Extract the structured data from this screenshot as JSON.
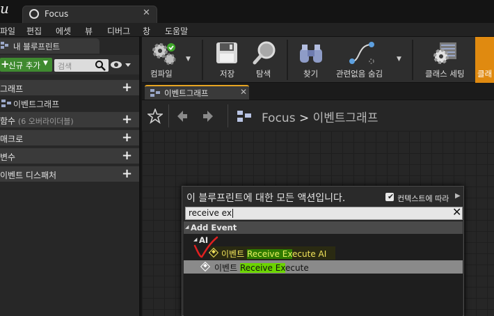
{
  "window": {
    "tab_title": "Focus",
    "close_glyph": "✕"
  },
  "menubar": {
    "items": [
      "파일",
      "편집",
      "에셋",
      "뷰",
      "디버그",
      "창",
      "도움말"
    ]
  },
  "left_panel": {
    "tab_label": "내 블루프린트",
    "add_new_label": "신규 추가",
    "search_placeholder": "검색",
    "sections": {
      "graphs": "그래프",
      "event_graph": "이벤트그래프",
      "functions": "함수",
      "functions_sub": "(6 오버라이더블)",
      "macros": "매크로",
      "variables": "변수",
      "event_dispatchers": "이벤트 디스패처"
    }
  },
  "toolbar": {
    "compile": "컴파일",
    "save": "저장",
    "browse": "탐색",
    "find": "찾기",
    "hide_unrelated": "관련없음 숨김",
    "class_settings": "클래스 세팅",
    "class_defaults": "클래"
  },
  "graph_tab": {
    "label": "이벤트그래프"
  },
  "breadcrumb": {
    "root": "Focus",
    "separator": ">",
    "graph": "이벤트그래프"
  },
  "action_menu": {
    "title": "이 블루프린트에 대한 모든 액션입니다.",
    "context_sensitive_label": "컨텍스트에 따라",
    "context_sensitive_checked": true,
    "search_value": "receive ex",
    "category": "Add Event",
    "subcategory": "AI",
    "results": [
      {
        "prefix": "이벤트 ",
        "match": "Receive Ex",
        "suffix": "ecute AI"
      },
      {
        "prefix": "이벤트 ",
        "match": "Receive Ex",
        "suffix": "ecute"
      }
    ]
  },
  "colors": {
    "accent_tab": "#e8a522",
    "add_button": "#3f8a30",
    "search_highlight": "#6bd400",
    "annotation_red": "#e02020"
  }
}
